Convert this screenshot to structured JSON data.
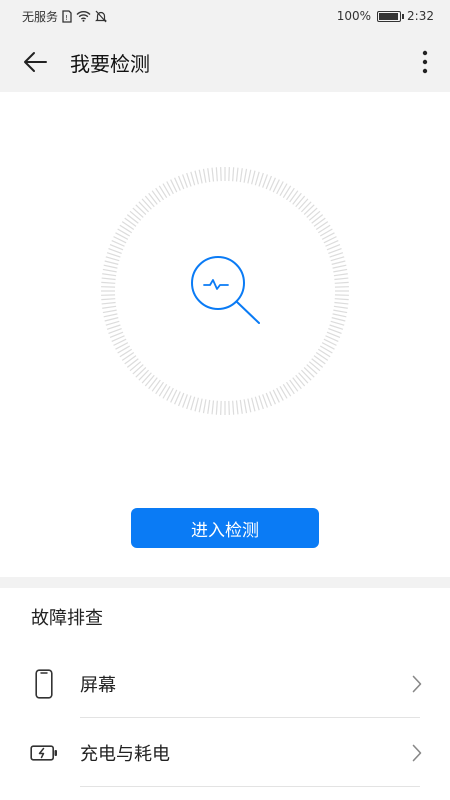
{
  "status_bar": {
    "carrier": "无服务",
    "battery": "100%",
    "time": "2:32"
  },
  "appbar": {
    "title": "我要检测"
  },
  "hero": {
    "button_label": "进入检测"
  },
  "troubleshoot": {
    "title": "故障排查",
    "items": [
      {
        "label": "屏幕",
        "icon": "phone-icon"
      },
      {
        "label": "充电与耗电",
        "icon": "battery-charging-icon"
      }
    ]
  },
  "colors": {
    "accent": "#0a7bf5",
    "background": "#f2f2f2"
  }
}
